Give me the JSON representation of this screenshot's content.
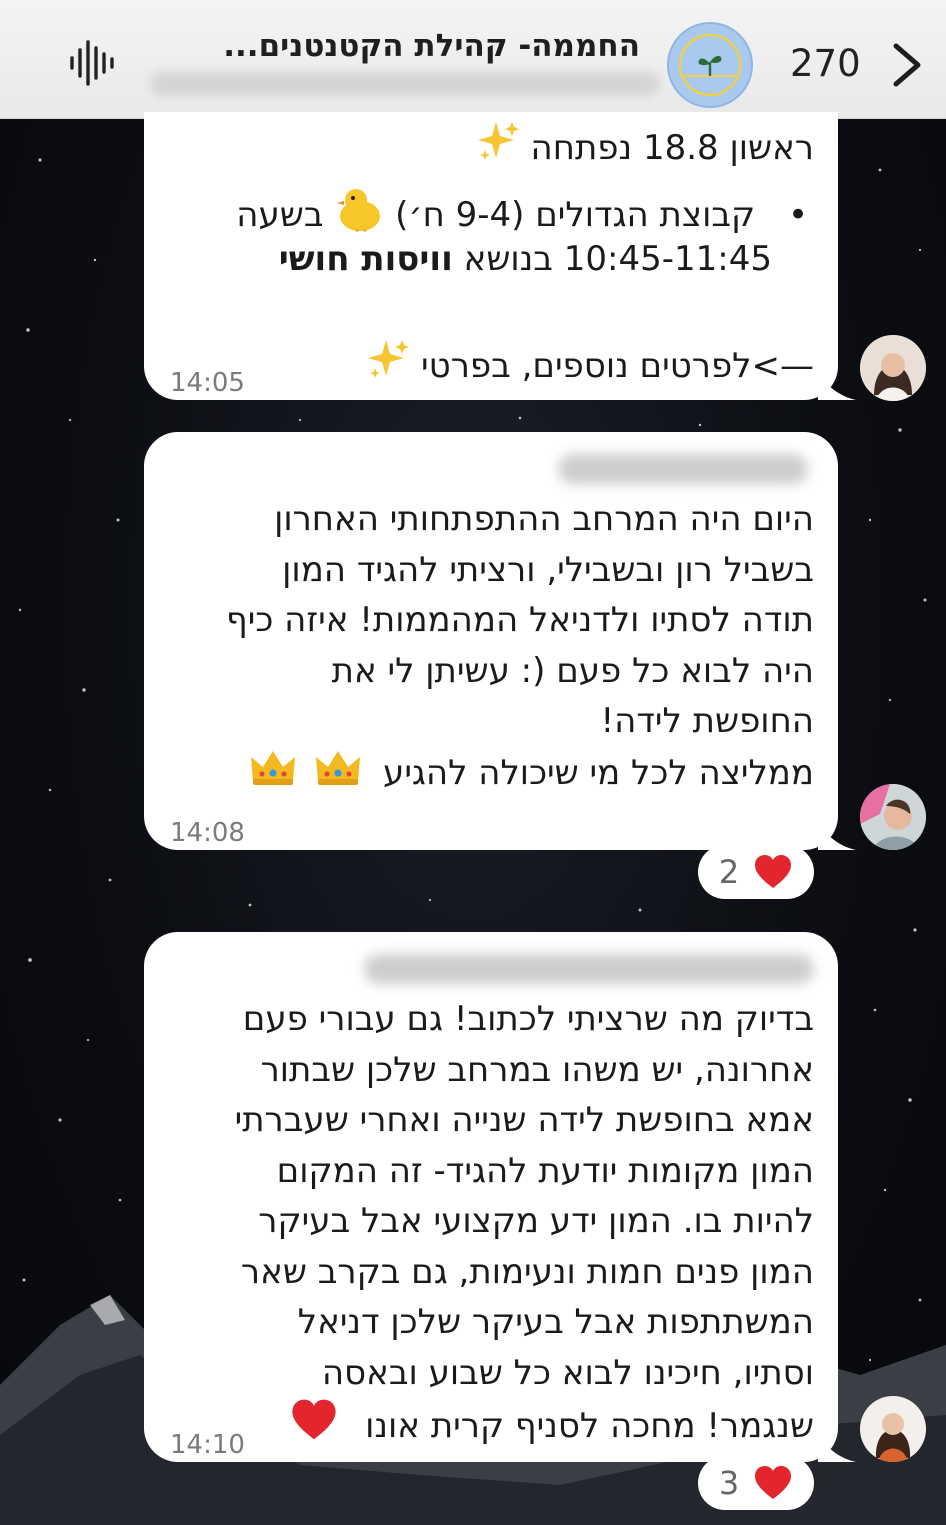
{
  "header": {
    "title": "החממה- קהילת הקטנטנים...",
    "member_count": "270"
  },
  "messages": [
    {
      "line1": "ראשון 18.8 נפתחה",
      "bullet": "•",
      "line2": "קבוצת הגדולים (9-4 ח׳)",
      "line2b": "בשעה",
      "line3": "10:45-11:45 בנושא",
      "line3_bold": "וויסות חושי",
      "line4": "—>לפרטים נוספים, בפרטי",
      "time": "14:05"
    },
    {
      "lines": [
        "היום היה המרחב ההתפתחותי האחרון",
        "בשביל רון ובשבילי, ורציתי להגיד המון",
        "תודה לסתיו ולדניאל המהממות! איזה כיף",
        "היה לבוא כל פעם (: עשיתן לי את",
        "החופשת לידה!"
      ],
      "last_line": "ממליצה לכל מי שיכולה להגיע",
      "time": "14:08",
      "reaction_count": "2"
    },
    {
      "lines": [
        "בדיוק מה שרציתי לכתוב! גם עבורי פעם",
        "אחרונה, יש משהו במרחב שלכן שבתור",
        "אמא בחופשת לידה שנייה ואחרי שעברתי",
        "המון מקומות יודעת להגיד- זה המקום",
        "להיות בו. המון ידע מקצועי אבל בעיקר",
        "המון פנים חמות ונעימות, גם בקרב שאר",
        "המשתתפות אבל בעיקר שלכן דניאל",
        "וסתיו, חיכינו לבוא כל שבוע ובאסה"
      ],
      "last_line": "שנגמר! מחכה לסניף קרית אונו",
      "time": "14:10",
      "reaction_count": "3"
    }
  ],
  "colors": {
    "heart": "#e3262e",
    "bubble": "#ffffff",
    "timestamp": "#7b7b7b"
  }
}
